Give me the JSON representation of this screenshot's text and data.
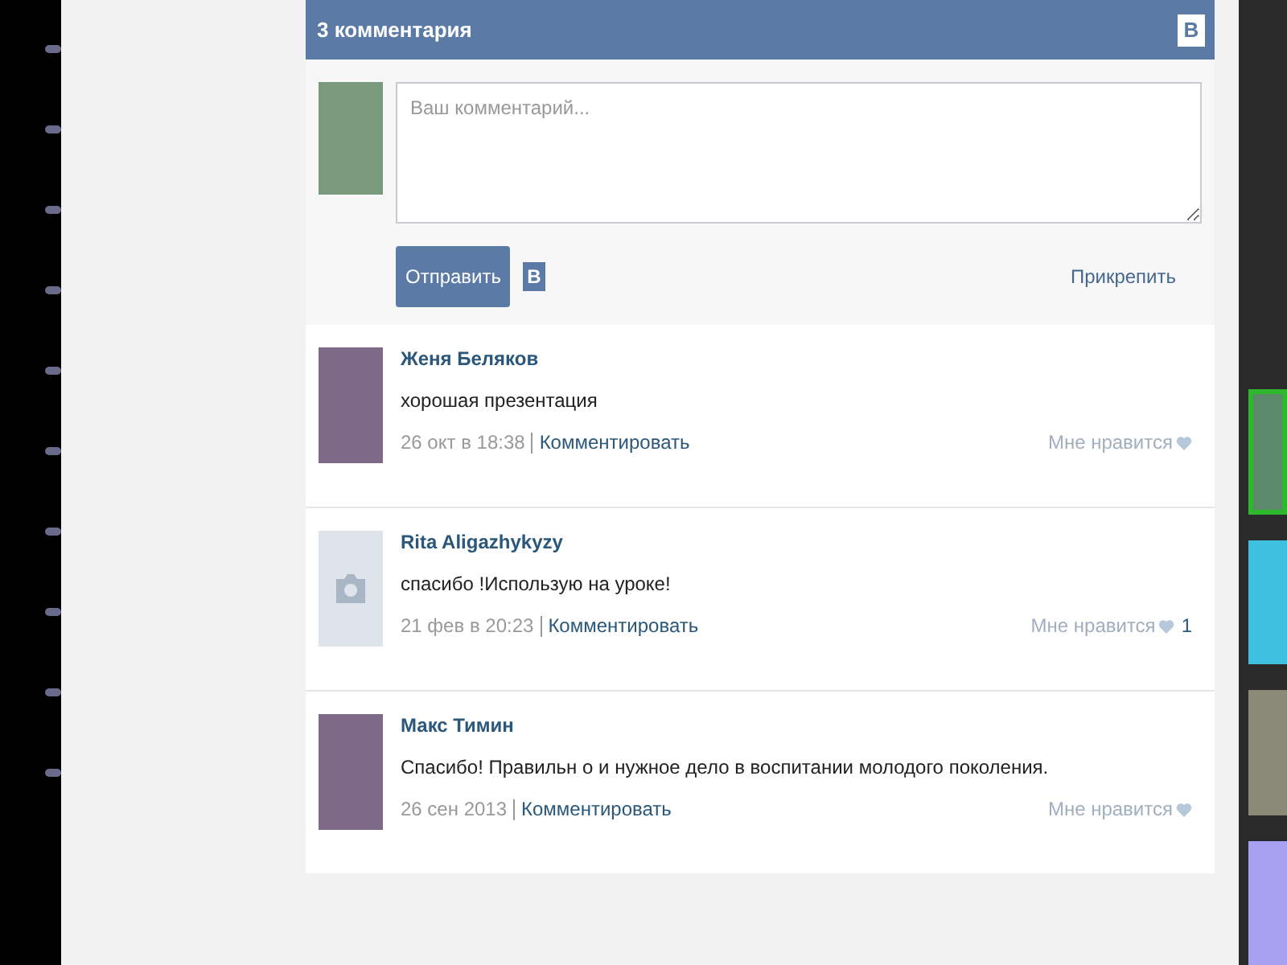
{
  "header": {
    "title": "3 комментария",
    "logo": "В"
  },
  "compose": {
    "placeholder": "Ваш комментарий...",
    "submit": "Отправить",
    "logo": "В",
    "attach": "Прикрепить"
  },
  "comments": [
    {
      "author": "Женя Беляков",
      "kind": "photo",
      "text": "хорошая презентация",
      "date": "26 окт в 18:38",
      "reply": "Комментировать",
      "like": "Мне нравится"
    },
    {
      "author": "Rita Aligazhykyzy",
      "kind": "placeholder",
      "text": "спасибо !Использую на уроке!",
      "date": "21 фев в 20:23",
      "reply": "Комментировать",
      "like": "Мне нравится",
      "likes": "1"
    },
    {
      "author": "Макс Тимин",
      "kind": "photo",
      "text": "Спасибо! Правильн о и нужное дело в воспитании молодого поколения.",
      "date": "26 сен 2013",
      "reply": "Комментировать",
      "like": "Мне нравится"
    }
  ],
  "slides": [
    {
      "selected": true
    },
    {
      "selected": false
    },
    {
      "selected": false
    },
    {
      "selected": false
    }
  ]
}
